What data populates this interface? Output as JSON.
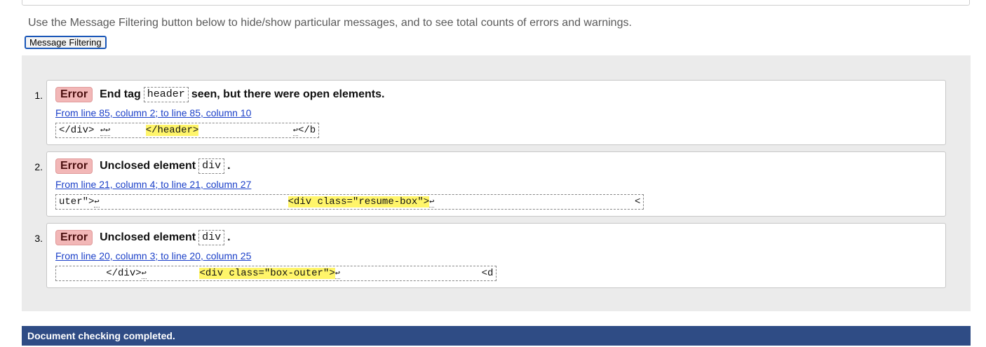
{
  "intro_text": "Use the Message Filtering button below to hide/show particular messages, and to see total counts of errors and warnings.",
  "filter_button_label": "Message Filtering",
  "messages": [
    {
      "number": "1.",
      "type": "Error",
      "text_before": "End tag",
      "code": "header",
      "text_after": "seen, but there were open elements.",
      "location": "From line 85, column 2; to line 85, column 10",
      "extract_before": "</div> ",
      "extract_before_nl": "↩↩",
      "extract_gap1": "      ",
      "extract_highlight": "</header>",
      "extract_gap2": "                ",
      "extract_after_nl": "↩",
      "extract_after": "</b"
    },
    {
      "number": "2.",
      "type": "Error",
      "text_before": "Unclosed element",
      "code": "div",
      "text_after": ".",
      "location": "From line 21, column 4; to line 21, column 27",
      "extract_before": "uter\">",
      "extract_before_nl": "↩",
      "extract_gap1": "                                ",
      "extract_highlight": "<div class=\"resume-box\">",
      "extract_after_nl": "↩",
      "extract_gap2": "                                  ",
      "extract_after": "<"
    },
    {
      "number": "3.",
      "type": "Error",
      "text_before": "Unclosed element",
      "code": "div",
      "text_after": ".",
      "location": "From line 20, column 3; to line 20, column 25",
      "extract_before": "        </div>",
      "extract_before_nl": "↩",
      "extract_gap1": "         ",
      "extract_highlight": "<div class=\"box-outer\">",
      "extract_after_nl": "↩",
      "extract_gap2": "                        ",
      "extract_after": "<d"
    }
  ],
  "status_text": "Document checking completed.",
  "colors": {
    "error_badge_bg": "#f2b7b7",
    "highlight": "#fff56a",
    "link": "#1a3fc8",
    "status_bar": "#2f4c85",
    "panel_bg": "#ebebeb"
  }
}
